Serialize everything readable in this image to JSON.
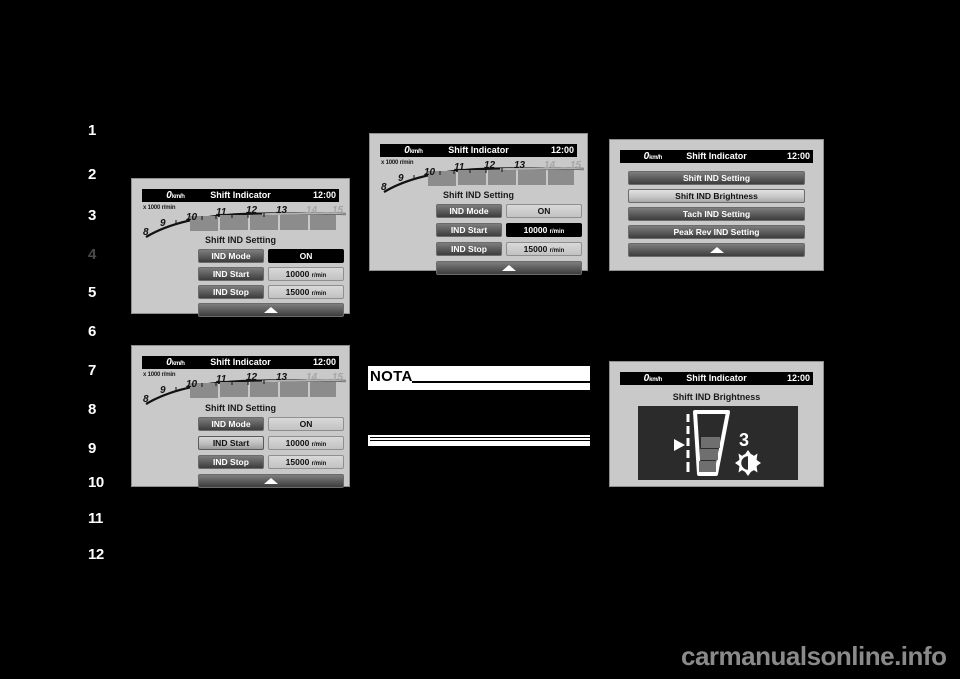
{
  "page": {
    "background_color": "#000000",
    "watermark": "carmanualsonline.info"
  },
  "sidebar": {
    "name": "chapter-tab-strip",
    "items": [
      {
        "label": "1",
        "active": true
      },
      {
        "label": "2",
        "active": true
      },
      {
        "label": "3",
        "active": true
      },
      {
        "label": "4",
        "active": false
      },
      {
        "label": "5",
        "active": true
      },
      {
        "label": "6",
        "active": true
      },
      {
        "label": "7",
        "active": true
      },
      {
        "label": "8",
        "active": true
      },
      {
        "label": "9",
        "active": true
      },
      {
        "label": "10",
        "active": true
      },
      {
        "label": "11",
        "active": true
      },
      {
        "label": "12",
        "active": true
      }
    ]
  },
  "common": {
    "speed_value": "0",
    "speed_unit": "km/h",
    "screen_title": "Shift Indicator",
    "clock": "12:00",
    "tach_unit_label": "x 1000 r/min",
    "tach_ticks": [
      "8",
      "9",
      "10",
      "11",
      "12",
      "13",
      "14",
      "15"
    ],
    "section_title": "Shift IND Setting",
    "return_icon": "up-triangle-icon"
  },
  "panel_1": {
    "name": "shift-ind-setting-overview",
    "rows": [
      {
        "label": "IND Mode",
        "value": "ON",
        "unit": "",
        "label_selected": false,
        "value_selected": true
      },
      {
        "label": "IND Start",
        "value": "10000",
        "unit": "r/min",
        "label_selected": false,
        "value_selected": false
      },
      {
        "label": "IND Stop",
        "value": "15000",
        "unit": "r/min",
        "label_selected": false,
        "value_selected": false
      }
    ]
  },
  "panel_2": {
    "name": "shift-ind-setting-start-edit",
    "rows": [
      {
        "label": "IND Mode",
        "value": "ON",
        "unit": "",
        "label_selected": false,
        "value_selected": false
      },
      {
        "label": "IND Start",
        "value": "10000",
        "unit": "r/min",
        "label_selected": false,
        "value_selected": true
      },
      {
        "label": "IND Stop",
        "value": "15000",
        "unit": "r/min",
        "label_selected": false,
        "value_selected": false
      }
    ]
  },
  "panel_3": {
    "name": "shift-indicator-menu",
    "items": [
      {
        "label": "Shift IND Setting",
        "selected": false
      },
      {
        "label": "Shift IND Brightness",
        "selected": true
      },
      {
        "label": "Tach IND Setting",
        "selected": false
      },
      {
        "label": "Peak Rev IND Setting",
        "selected": false
      }
    ]
  },
  "panel_4": {
    "name": "shift-ind-setting-mode-selected",
    "rows": [
      {
        "label": "IND Mode",
        "value": "ON",
        "unit": "",
        "label_selected": false,
        "value_selected": false
      },
      {
        "label": "IND Start",
        "value": "10000",
        "unit": "r/min",
        "label_selected": true,
        "value_selected": false
      },
      {
        "label": "IND Stop",
        "value": "15000",
        "unit": "r/min",
        "label_selected": false,
        "value_selected": false
      }
    ]
  },
  "panel_5": {
    "name": "shift-ind-brightness",
    "title": "Shift IND Brightness",
    "level_value": "3",
    "level_max": 5,
    "level_filled": 3,
    "pointer_icon": "right-triangle-pointer-icon",
    "brightness_icon": "sun-brightness-icon"
  },
  "nota": {
    "heading": "NOTA",
    "body": ""
  }
}
